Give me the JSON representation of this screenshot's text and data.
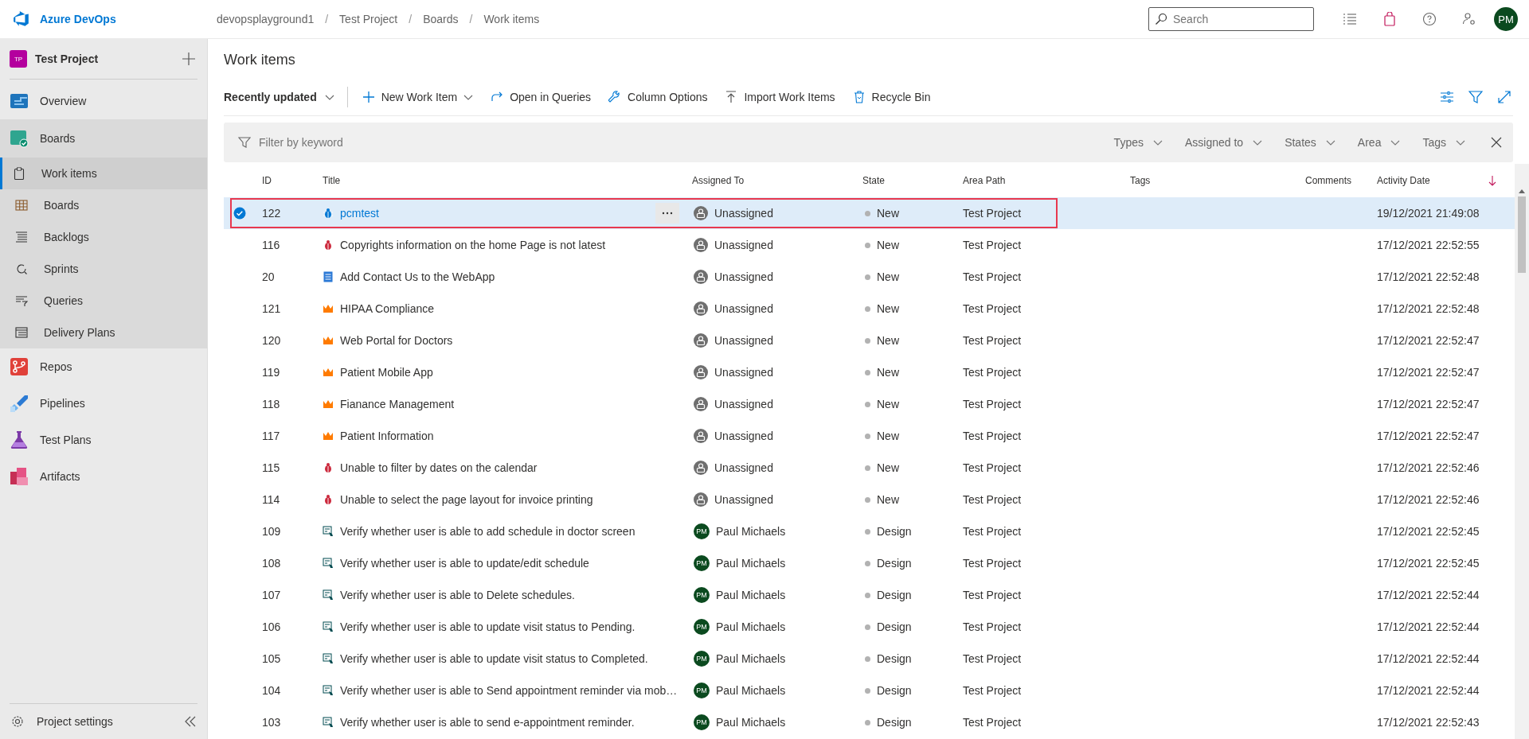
{
  "header": {
    "logo_text": "Azure DevOps",
    "breadcrumbs": [
      "devopsplayground1",
      "/",
      "Test Project",
      "/",
      "Boards",
      "/",
      "Work items"
    ],
    "search": {
      "placeholder": "Search"
    },
    "avatar": "PM"
  },
  "sidebar": {
    "project": {
      "badge": "TP",
      "name": "Test Project"
    },
    "items": [
      {
        "label": "Overview",
        "expanded": false
      },
      {
        "label": "Boards",
        "expanded": true,
        "children": [
          {
            "label": "Work items",
            "selected": true
          },
          {
            "label": "Boards",
            "selected": false
          },
          {
            "label": "Backlogs",
            "selected": false
          },
          {
            "label": "Sprints",
            "selected": false
          },
          {
            "label": "Queries",
            "selected": false
          },
          {
            "label": "Delivery Plans",
            "selected": false
          }
        ]
      },
      {
        "label": "Repos",
        "expanded": false
      },
      {
        "label": "Pipelines",
        "expanded": false
      },
      {
        "label": "Test Plans",
        "expanded": false
      },
      {
        "label": "Artifacts",
        "expanded": false
      }
    ],
    "settings": "Project settings"
  },
  "page_title": "Work items",
  "toolbar": {
    "view": "Recently updated",
    "actions": [
      {
        "label": "New Work Item",
        "dropdown": true
      },
      {
        "label": "Open in Queries",
        "dropdown": false
      },
      {
        "label": "Column Options",
        "dropdown": false
      },
      {
        "label": "Import Work Items",
        "dropdown": false
      },
      {
        "label": "Recycle Bin",
        "dropdown": false
      }
    ]
  },
  "filter": {
    "placeholder": "Filter by keyword",
    "dropdowns": [
      "Types",
      "Assigned to",
      "States",
      "Area",
      "Tags"
    ]
  },
  "table": {
    "columns": [
      "ID",
      "Title",
      "Assigned To",
      "State",
      "Area Path",
      "Tags",
      "Comments",
      "Activity Date"
    ],
    "rows": [
      {
        "id": "122",
        "kind": "bug",
        "title": "pcmtest",
        "assignee": {
          "kind": "unassigned",
          "name": "Unassigned"
        },
        "state": "New",
        "area": "Test Project",
        "date": "19/12/2021 21:49:08",
        "selected": true,
        "highlighted": true
      },
      {
        "id": "116",
        "kind": "bug",
        "title": "Copyrights information on the home Page is not latest",
        "assignee": {
          "kind": "unassigned",
          "name": "Unassigned"
        },
        "state": "New",
        "area": "Test Project",
        "date": "17/12/2021 22:52:55",
        "selected": false,
        "highlighted": false
      },
      {
        "id": "20",
        "kind": "story",
        "title": "Add Contact Us to the WebApp",
        "assignee": {
          "kind": "unassigned",
          "name": "Unassigned"
        },
        "state": "New",
        "area": "Test Project",
        "date": "17/12/2021 22:52:48",
        "selected": false,
        "highlighted": false
      },
      {
        "id": "121",
        "kind": "epic",
        "title": "HIPAA Compliance",
        "assignee": {
          "kind": "unassigned",
          "name": "Unassigned"
        },
        "state": "New",
        "area": "Test Project",
        "date": "17/12/2021 22:52:48",
        "selected": false,
        "highlighted": false
      },
      {
        "id": "120",
        "kind": "epic",
        "title": "Web Portal for Doctors",
        "assignee": {
          "kind": "unassigned",
          "name": "Unassigned"
        },
        "state": "New",
        "area": "Test Project",
        "date": "17/12/2021 22:52:47",
        "selected": false,
        "highlighted": false
      },
      {
        "id": "119",
        "kind": "epic",
        "title": "Patient Mobile App",
        "assignee": {
          "kind": "unassigned",
          "name": "Unassigned"
        },
        "state": "New",
        "area": "Test Project",
        "date": "17/12/2021 22:52:47",
        "selected": false,
        "highlighted": false
      },
      {
        "id": "118",
        "kind": "epic",
        "title": "Fianance Management",
        "assignee": {
          "kind": "unassigned",
          "name": "Unassigned"
        },
        "state": "New",
        "area": "Test Project",
        "date": "17/12/2021 22:52:47",
        "selected": false,
        "highlighted": false
      },
      {
        "id": "117",
        "kind": "epic",
        "title": "Patient Information",
        "assignee": {
          "kind": "unassigned",
          "name": "Unassigned"
        },
        "state": "New",
        "area": "Test Project",
        "date": "17/12/2021 22:52:47",
        "selected": false,
        "highlighted": false
      },
      {
        "id": "115",
        "kind": "bug",
        "title": "Unable to filter by dates on the calendar",
        "assignee": {
          "kind": "unassigned",
          "name": "Unassigned"
        },
        "state": "New",
        "area": "Test Project",
        "date": "17/12/2021 22:52:46",
        "selected": false,
        "highlighted": false
      },
      {
        "id": "114",
        "kind": "bug",
        "title": "Unable to select the page layout for invoice printing",
        "assignee": {
          "kind": "unassigned",
          "name": "Unassigned"
        },
        "state": "New",
        "area": "Test Project",
        "date": "17/12/2021 22:52:46",
        "selected": false,
        "highlighted": false
      },
      {
        "id": "109",
        "kind": "testcase",
        "title": "Verify whether user is able to add schedule in doctor screen",
        "assignee": {
          "kind": "person",
          "name": "Paul Michaels",
          "initials": "PM"
        },
        "state": "Design",
        "area": "Test Project",
        "date": "17/12/2021 22:52:45",
        "selected": false,
        "highlighted": false
      },
      {
        "id": "108",
        "kind": "testcase",
        "title": "Verify whether user is able to update/edit schedule",
        "assignee": {
          "kind": "person",
          "name": "Paul Michaels",
          "initials": "PM"
        },
        "state": "Design",
        "area": "Test Project",
        "date": "17/12/2021 22:52:45",
        "selected": false,
        "highlighted": false
      },
      {
        "id": "107",
        "kind": "testcase",
        "title": "Verify whether user is able to Delete schedules.",
        "assignee": {
          "kind": "person",
          "name": "Paul Michaels",
          "initials": "PM"
        },
        "state": "Design",
        "area": "Test Project",
        "date": "17/12/2021 22:52:44",
        "selected": false,
        "highlighted": false
      },
      {
        "id": "106",
        "kind": "testcase",
        "title": "Verify whether user is able to update visit status to Pending.",
        "assignee": {
          "kind": "person",
          "name": "Paul Michaels",
          "initials": "PM"
        },
        "state": "Design",
        "area": "Test Project",
        "date": "17/12/2021 22:52:44",
        "selected": false,
        "highlighted": false
      },
      {
        "id": "105",
        "kind": "testcase",
        "title": "Verify whether user is able to update visit status to Completed.",
        "assignee": {
          "kind": "person",
          "name": "Paul Michaels",
          "initials": "PM"
        },
        "state": "Design",
        "area": "Test Project",
        "date": "17/12/2021 22:52:44",
        "selected": false,
        "highlighted": false
      },
      {
        "id": "104",
        "kind": "testcase",
        "title": "Verify whether user is able to Send appointment reminder via mob…",
        "assignee": {
          "kind": "person",
          "name": "Paul Michaels",
          "initials": "PM"
        },
        "state": "Design",
        "area": "Test Project",
        "date": "17/12/2021 22:52:44",
        "selected": false,
        "highlighted": false
      },
      {
        "id": "103",
        "kind": "testcase",
        "title": "Verify whether user is able to send e-appointment reminder.",
        "assignee": {
          "kind": "person",
          "name": "Paul Michaels",
          "initials": "PM"
        },
        "state": "Design",
        "area": "Test Project",
        "date": "17/12/2021 22:52:43",
        "selected": false,
        "highlighted": false
      }
    ]
  }
}
